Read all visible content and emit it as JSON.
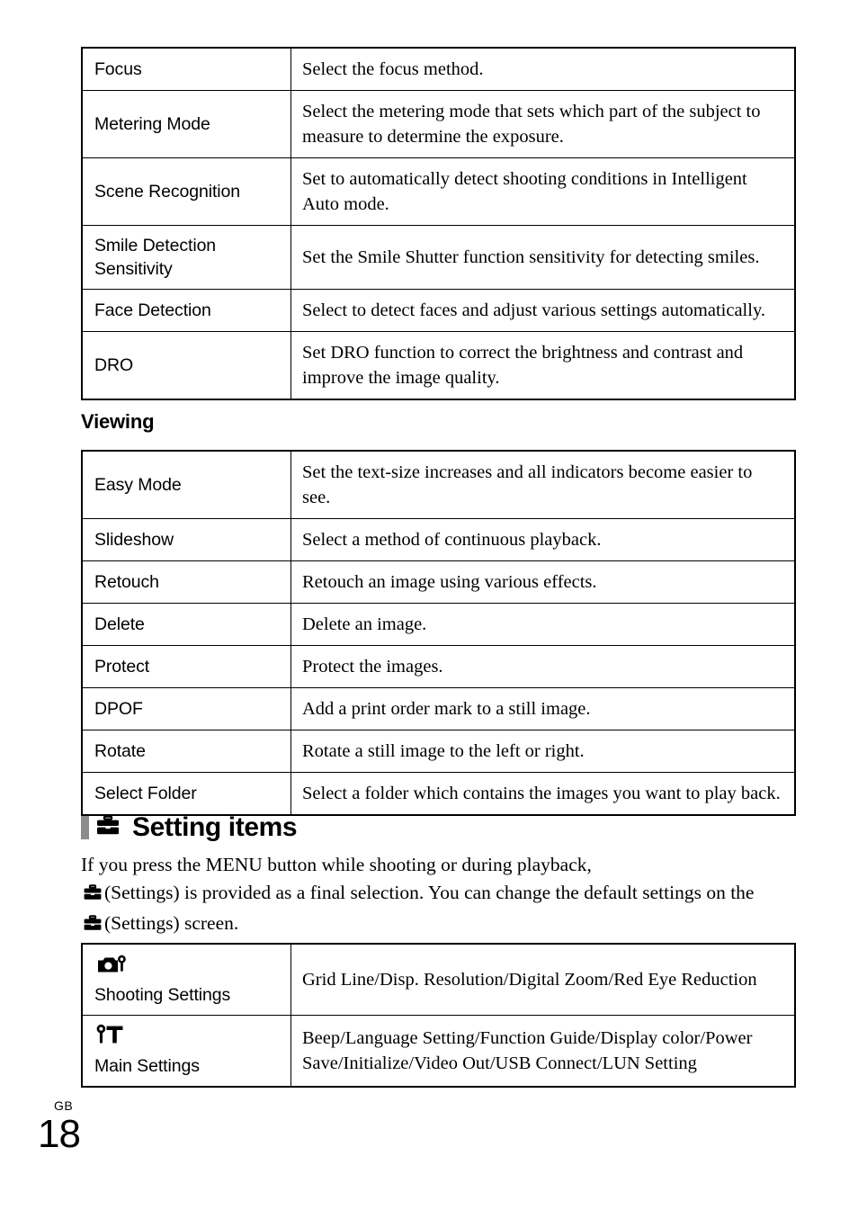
{
  "page": {
    "number": "18",
    "region_code": "GB"
  },
  "tables": {
    "shooting": {
      "rows": [
        {
          "term": "Focus",
          "desc": "Select the focus method."
        },
        {
          "term": "Metering Mode",
          "desc": "Select the metering mode that sets which part of the subject to measure to determine the exposure."
        },
        {
          "term": "Scene Recognition",
          "desc": "Set to automatically detect shooting conditions in Intelligent Auto mode."
        },
        {
          "term": "Smile Detection Sensitivity",
          "desc": "Set the Smile Shutter function sensitivity for detecting smiles."
        },
        {
          "term": "Face Detection",
          "desc": "Select to detect faces and adjust various settings automatically."
        },
        {
          "term": "DRO",
          "desc": "Set DRO function to correct the brightness and contrast and improve the image quality."
        }
      ]
    },
    "viewing": {
      "heading": "Viewing",
      "rows": [
        {
          "term": "Easy Mode",
          "desc": "Set the text-size increases and all indicators become easier to see."
        },
        {
          "term": "Slideshow",
          "desc": "Select a method of continuous playback."
        },
        {
          "term": "Retouch",
          "desc": "Retouch an image using various effects."
        },
        {
          "term": "Delete",
          "desc": "Delete an image."
        },
        {
          "term": "Protect",
          "desc": "Protect the images."
        },
        {
          "term": "DPOF",
          "desc": "Add a print order mark to a still image."
        },
        {
          "term": "Rotate",
          "desc": "Rotate a still image to the left or right."
        },
        {
          "term": "Select Folder",
          "desc": "Select a folder which contains the images you want to play back."
        }
      ]
    },
    "settings": {
      "rows": [
        {
          "icon": "camera-wrench-icon",
          "term": "Shooting Settings",
          "desc": "Grid Line/Disp. Resolution/Digital Zoom/Red Eye Reduction"
        },
        {
          "icon": "wrench-hammer-icon",
          "term": "Main Settings",
          "desc": "Beep/Language Setting/Function Guide/Display color/Power Save/Initialize/Video Out/USB Connect/LUN Setting"
        }
      ]
    }
  },
  "setting_items_section": {
    "heading": "Setting items",
    "heading_icon": "toolbox-icon",
    "paragraph_part_1": "If you press the MENU button while shooting or during playback,",
    "paragraph_part_2": "(Settings) is provided as a final selection. You can change the default settings on the",
    "paragraph_part_3": "(Settings) screen."
  },
  "colors": {
    "text": "#000000",
    "rule": "#000000",
    "heading_bar": "#8c8c8c",
    "background": "#ffffff"
  }
}
